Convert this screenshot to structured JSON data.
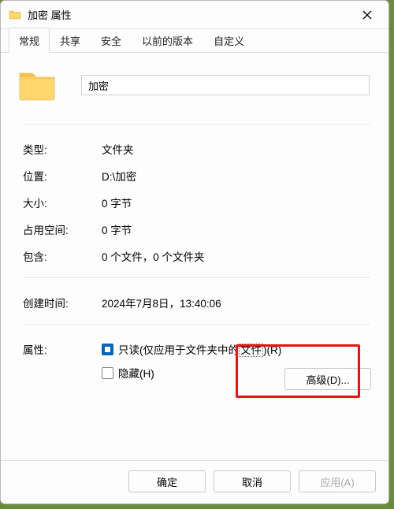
{
  "title": "加密 属性",
  "tabs": [
    "常规",
    "共享",
    "安全",
    "以前的版本",
    "自定义"
  ],
  "folder_name": "加密",
  "props": {
    "type_label": "类型:",
    "type_value": "文件夹",
    "location_label": "位置:",
    "location_value": "D:\\加密",
    "size_label": "大小:",
    "size_value": "0 字节",
    "disk_label": "占用空间:",
    "disk_value": "0 字节",
    "contains_label": "包含:",
    "contains_value": "0 个文件，0 个文件夹",
    "created_label": "创建时间:",
    "created_value": "2024年7月8日，13:40:06",
    "attr_label": "属性:"
  },
  "readonly": {
    "prefix": "只读(仅应用于文件夹中的",
    "dotted": "文件",
    "suffix": ")(R)"
  },
  "hidden_label": "隐藏(H)",
  "advanced_label": "高级(D)...",
  "buttons": {
    "ok": "确定",
    "cancel": "取消",
    "apply": "应用(A)"
  }
}
